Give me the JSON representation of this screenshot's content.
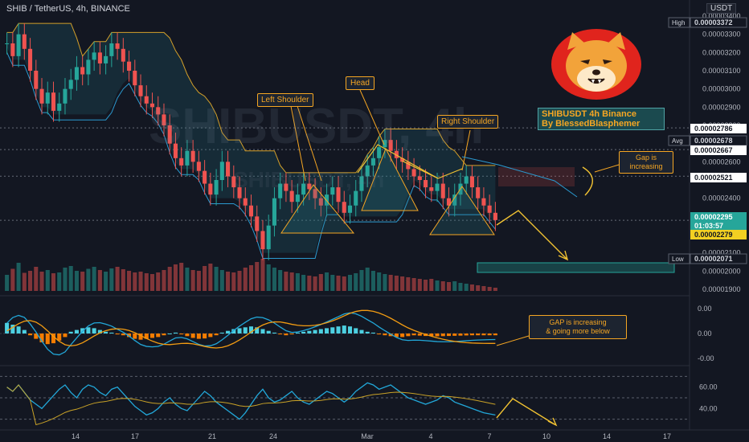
{
  "header": {
    "symbol": "SHIB / TetherUS, 4h, BINANCE",
    "currency": "USDT"
  },
  "watermark": "SHIBUSDT, 4h",
  "watermark_sub": "SHIBUSDT, 4h",
  "colors": {
    "background": "#131722",
    "up": "#26a69a",
    "down": "#ef5350",
    "annotation": "#f5a623",
    "cloud": "#2a3f4a",
    "macd": "#22a7d8",
    "signal": "#f39c12",
    "rsi": "#22a7d8"
  },
  "price_axis": {
    "ticks": [
      "0.00003400",
      "0.00003300",
      "0.00003200",
      "0.00003100",
      "0.00003000",
      "0.00002900",
      "0.00002800",
      "0.00002700",
      "0.00002600",
      "0.00002500",
      "0.00002400",
      "0.00002300",
      "0.00002200",
      "0.00002100",
      "0.00002000",
      "0.00001900"
    ],
    "badges": [
      {
        "key": "high",
        "label": "High",
        "value": "0.00003372"
      },
      {
        "key": "l1",
        "label": "",
        "value": "0.00002786"
      },
      {
        "key": "avg",
        "label": "Avg",
        "value": "0.00002678"
      },
      {
        "key": "l2",
        "label": "",
        "value": "0.00002667"
      },
      {
        "key": "l3",
        "label": "",
        "value": "0.00002521"
      },
      {
        "key": "last",
        "label": "",
        "value": "0.00002295"
      },
      {
        "key": "countdown",
        "label": "",
        "value": "01:03:57"
      },
      {
        "key": "l4",
        "label": "",
        "value": "0.00002279"
      },
      {
        "key": "low",
        "label": "Low",
        "value": "0.00002071"
      }
    ]
  },
  "macd_axis": {
    "ticks": [
      "0.00",
      "0.00",
      "-0.00"
    ]
  },
  "rsi_axis": {
    "ticks": [
      "60.00",
      "40.00"
    ]
  },
  "time_axis": {
    "ticks": [
      "14",
      "17",
      "21",
      "24",
      "Mar",
      "4",
      "7",
      "10",
      "14",
      "17"
    ]
  },
  "annotations": {
    "left_shoulder": "Left Shoulder",
    "head": "Head",
    "right_shoulder": "Right Shoulder",
    "title_line1": "SHIBUSDT 4h Binance",
    "title_line2": "By BlessedBlasphemer",
    "gap1_line1": "Gap is",
    "gap1_line2": "increasing",
    "gap2_line1": "GAP is increasing",
    "gap2_line2": "& going more below"
  },
  "chart_data": {
    "type": "candlestick",
    "timeframe": "4h",
    "ylim": [
      1.9e-05,
      3.4e-05
    ],
    "close_series": [
      3.25e-05,
      3.18e-05,
      3.3e-05,
      3.22e-05,
      3.1e-05,
      3e-05,
      2.92e-05,
      2.98e-05,
      2.88e-05,
      2.92e-05,
      3e-05,
      3.05e-05,
      3.12e-05,
      3.08e-05,
      3.16e-05,
      3.2e-05,
      3.14e-05,
      3.18e-05,
      3.25e-05,
      3.22e-05,
      3.15e-05,
      3.1e-05,
      3.02e-05,
      2.96e-05,
      2.92e-05,
      2.9e-05,
      2.86e-05,
      2.8e-05,
      2.7e-05,
      2.62e-05,
      2.58e-05,
      2.66e-05,
      2.6e-05,
      2.55e-05,
      2.48e-05,
      2.42e-05,
      2.5e-05,
      2.6e-05,
      2.52e-05,
      2.46e-05,
      2.4e-05,
      2.36e-05,
      2.3e-05,
      2.22e-05,
      2.12e-05,
      2.25e-05,
      2.4e-05,
      2.48e-05,
      2.44e-05,
      2.38e-05,
      2.42e-05,
      2.48e-05,
      2.45e-05,
      2.4e-05,
      2.36e-05,
      2.42e-05,
      2.46e-05,
      2.38e-05,
      2.32e-05,
      2.36e-05,
      2.44e-05,
      2.52e-05,
      2.58e-05,
      2.62e-05,
      2.68e-05,
      2.72e-05,
      2.66e-05,
      2.62e-05,
      2.6e-05,
      2.56e-05,
      2.52e-05,
      2.5e-05,
      2.46e-05,
      2.44e-05,
      2.48e-05,
      2.4e-05,
      2.36e-05,
      2.42e-05,
      2.48e-05,
      2.52e-05,
      2.46e-05,
      2.4e-05,
      2.36e-05,
      2.32e-05,
      2.28e-05
    ],
    "volume": [
      40,
      55,
      70,
      45,
      50,
      60,
      48,
      52,
      44,
      46,
      58,
      62,
      50,
      48,
      55,
      60,
      52,
      48,
      56,
      60,
      54,
      50,
      46,
      48,
      44,
      42,
      46,
      52,
      60,
      66,
      70,
      58,
      52,
      50,
      62,
      68,
      60,
      52,
      48,
      46,
      50,
      58,
      64,
      72,
      80,
      66,
      58,
      52,
      48,
      46,
      44,
      40,
      38,
      36,
      42,
      46,
      40,
      38,
      36,
      40,
      44,
      52,
      58,
      50,
      46,
      42,
      40,
      38,
      36,
      34,
      32,
      30,
      28,
      30,
      26,
      24,
      22,
      24,
      20,
      18,
      16,
      14,
      12,
      10,
      8
    ],
    "macd_hist": [
      0.6,
      0.5,
      0.4,
      0.2,
      -0.1,
      -0.3,
      -0.5,
      -0.6,
      -0.55,
      -0.4,
      -0.2,
      0.1,
      0.2,
      0.3,
      0.35,
      0.3,
      0.2,
      0.1,
      0.05,
      -0.05,
      -0.1,
      -0.2,
      -0.3,
      -0.35,
      -0.3,
      -0.25,
      -0.2,
      -0.1,
      0.0,
      0.05,
      -0.05,
      -0.15,
      -0.25,
      -0.3,
      -0.28,
      -0.2,
      -0.1,
      0.05,
      0.15,
      0.25,
      0.3,
      0.35,
      0.4,
      0.35,
      0.25,
      0.15,
      0.05,
      -0.05,
      -0.1,
      -0.05,
      0.05,
      0.1,
      0.15,
      0.2,
      0.25,
      0.3,
      0.35,
      0.4,
      0.45,
      0.4,
      0.3,
      0.2,
      0.1,
      0.05,
      -0.05,
      -0.1,
      -0.15,
      -0.2,
      -0.2,
      -0.15,
      -0.1,
      -0.12,
      -0.14,
      -0.15,
      -0.16,
      -0.15,
      -0.14,
      -0.13,
      -0.12,
      -0.11,
      -0.1,
      -0.1,
      -0.1,
      -0.1,
      -0.1
    ],
    "rsi": [
      60,
      56,
      62,
      55,
      48,
      44,
      40,
      46,
      52,
      58,
      62,
      55,
      50,
      58,
      62,
      60,
      55,
      52,
      58,
      60,
      54,
      48,
      42,
      38,
      34,
      36,
      40,
      46,
      50,
      44,
      40,
      38,
      44,
      50,
      56,
      52,
      46,
      42,
      38,
      34,
      30,
      36,
      44,
      52,
      58,
      50,
      46,
      48,
      52,
      56,
      50,
      46,
      44,
      48,
      52,
      56,
      54,
      50,
      46,
      50,
      56,
      60,
      64,
      62,
      58,
      60,
      62,
      58,
      54,
      50,
      48,
      46,
      44,
      46,
      48,
      52,
      50,
      46,
      44,
      42,
      40,
      38,
      36,
      35,
      34
    ],
    "projection_note": "two arrows point to lower prices"
  }
}
